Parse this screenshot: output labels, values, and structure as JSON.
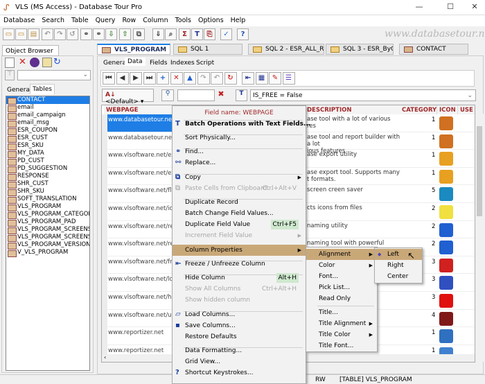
{
  "window": {
    "title": "VLS (MS Access) - Database Tour Pro",
    "minimize": "—",
    "maximize": "☐",
    "close": "✕"
  },
  "watermark": "www.databasetour.net",
  "menubar": [
    "Database",
    "Search",
    "Table",
    "Query",
    "Row",
    "Column",
    "Tools",
    "Options",
    "Help"
  ],
  "doc_tabs": [
    {
      "label": "VLS_PROGRAM",
      "active": true
    },
    {
      "label": "SQL 1"
    },
    {
      "label": "SQL 2 - ESR_ALL_RE..."
    },
    {
      "label": "SQL 3 - ESR_ByCou..."
    },
    {
      "label": "CONTACT"
    }
  ],
  "object_browser": {
    "title": "Object Browser",
    "tabs": [
      "General",
      "Tables"
    ],
    "active_tab": "Tables",
    "tables": [
      "CONTACT",
      "email",
      "email_campaign",
      "email_msg",
      "ESR_COUPON",
      "ESR_CUST",
      "ESR_SKU",
      "MY_DATA",
      "PD_CUST",
      "PD_SUGGESTION",
      "RESPONSE",
      "SHR_CUST",
      "SHR_SKU",
      "SOFT_TRANSLATION",
      "VLS_PROGRAM",
      "VLS_PROGRAM_CATEGORY",
      "VLS_PROGRAM_PAD",
      "VLS_PROGRAM_SCREENSHOT",
      "VLS_PROGRAM_SCREENSHOT",
      "VLS_PROGRAM_VERSION",
      "V_VLS_PROGRAM"
    ],
    "selected": "CONTACT"
  },
  "sub_tabs": [
    "General",
    "Data",
    "Fields",
    "Indexes",
    "Script"
  ],
  "active_sub_tab": "Data",
  "filter": {
    "sort": "<Default>",
    "search_value": "",
    "filter_expr": "IS_FREE = False"
  },
  "grid": {
    "columns": [
      "WEBPAGE",
      "DESCRIPTION",
      "CATEGORY",
      "ICON",
      "USE"
    ],
    "rows": [
      {
        "web": "www.databasetour.net",
        "desc": "ase tool with a lot of various\nres",
        "cat": "1",
        "icon": "#d07020"
      },
      {
        "web": "www.databasetour.net",
        "desc": "ase tool and report builder with a lot\nious features",
        "cat": "1",
        "icon": "#d07020"
      },
      {
        "web": "www.vlsoftware.net/expo",
        "desc": "ase export utility",
        "cat": "1",
        "icon": "#e8a020"
      },
      {
        "web": "www.vlsoftware.net/expo",
        "desc": "ase export tool. Supports many\nt formats.",
        "cat": "1",
        "icon": "#e8a020"
      },
      {
        "web": "www.vlsoftware.net/flying",
        "desc": "screen creen saver",
        "cat": "5",
        "icon": "#1a8ac0"
      },
      {
        "web": "www.vlsoftware.net/icons",
        "desc": "cts icons from files",
        "cat": "2",
        "icon": "#f0e040"
      },
      {
        "web": "www.vlsoftware.net/renar",
        "desc": "naming utility",
        "cat": "2",
        "icon": "#2060d0"
      },
      {
        "web": "www.vlsoftware.net/renar",
        "desc": "naming tool with powerful preview",
        "cat": "2",
        "icon": "#2060d0"
      },
      {
        "web": "www.vlsoftware.net/free-",
        "desc": "",
        "cat": "3",
        "icon": "#d02020"
      },
      {
        "web": "www.vlsoftware.net/logica",
        "desc": "",
        "cat": "3",
        "icon": "#3050c0"
      },
      {
        "web": "www.vlsoftware.net/hano",
        "desc": "",
        "cat": "3",
        "icon": "#e01010"
      },
      {
        "web": "www.vlsoftware.net/ua/pa",
        "desc": "ring",
        "cat": "4",
        "icon": "#801818"
      },
      {
        "web": "www.reportizer.net",
        "desc": "rinting",
        "cat": "1",
        "icon": "#3070c0"
      },
      {
        "web": "www.reportizer.net",
        "desc": "atabase",
        "cat": "1",
        "icon": "#4080d0"
      }
    ]
  },
  "status": {
    "mode": "RW",
    "object": "[TABLE] VLS_PROGRAM"
  },
  "context_menu": {
    "header": "Field name: WEBPAGE",
    "items": [
      {
        "label": "Batch Operations with Text Fields...",
        "bold": true,
        "icon": "text-icon"
      },
      {
        "label": "Sort Physically..."
      },
      {
        "label": "Find...",
        "icon": "binoculars-icon"
      },
      {
        "label": "Replace...",
        "icon": "replace-icon"
      },
      {
        "label": "Copy",
        "submenu": true,
        "icon": "copy-icon"
      },
      {
        "label": "Paste Cells from Clipboard...",
        "shortcut": "Ctrl+Alt+V",
        "disabled": true,
        "icon": "paste-icon"
      },
      {
        "label": "Duplicate Record"
      },
      {
        "label": "Batch Change Field Values..."
      },
      {
        "label": "Duplicate Field Value",
        "shortcut": "Ctrl+F5",
        "green": true
      },
      {
        "label": "Increment Field Value",
        "submenu": true,
        "disabled": true
      },
      {
        "label": "Column Properties",
        "submenu": true,
        "highlighted": true
      },
      {
        "label": "Freeze / Unfreeze Column",
        "icon": "freeze-icon"
      },
      {
        "label": "Hide Column",
        "shortcut": "Alt+H",
        "green": true
      },
      {
        "label": "Show All Columns",
        "shortcut": "Ctrl+Alt+H",
        "disabled": true
      },
      {
        "label": "Show hidden column",
        "disabled": true
      },
      {
        "label": "Load Columns...",
        "icon": "folder-icon"
      },
      {
        "label": "Save Columns...",
        "icon": "save-icon"
      },
      {
        "label": "Restore Defaults"
      },
      {
        "label": "Data Formatting..."
      },
      {
        "label": "Grid View..."
      },
      {
        "label": "Shortcut Keystrokes...",
        "icon": "help-icon"
      }
    ]
  },
  "column_properties_menu": [
    {
      "label": "Alignment",
      "submenu": true,
      "highlighted": true
    },
    {
      "label": "Color",
      "submenu": true
    },
    {
      "label": "Font..."
    },
    {
      "label": "Pick List..."
    },
    {
      "label": "Read Only"
    },
    {
      "label": "Title..."
    },
    {
      "label": "Title Alignment",
      "submenu": true
    },
    {
      "label": "Title Color",
      "submenu": true
    },
    {
      "label": "Title Font..."
    }
  ],
  "alignment_menu": [
    {
      "label": "Left",
      "checked": true,
      "highlighted": true
    },
    {
      "label": "Right"
    },
    {
      "label": "Center"
    }
  ],
  "colors": {
    "accent": "#1e7ee6",
    "menu_highlight": "#c9a878",
    "header_text": "#a0282a"
  }
}
